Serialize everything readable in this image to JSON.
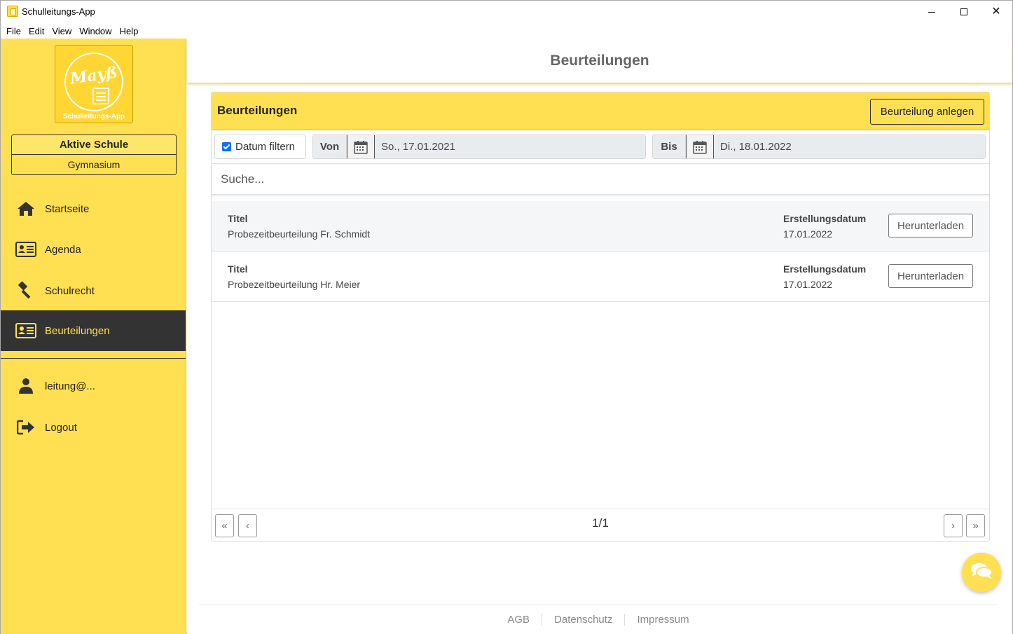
{
  "window": {
    "title": "Schulleitungs-App",
    "icon": "app-icon"
  },
  "menubar": [
    "File",
    "Edit",
    "View",
    "Window",
    "Help"
  ],
  "sidebar": {
    "logo_script": "Mayß",
    "logo_caption": "Schulleitungs-App",
    "school_heading": "Aktive Schule",
    "school_name": "Gymnasium",
    "items": [
      {
        "label": "Startseite",
        "icon": "home-icon"
      },
      {
        "label": "Agenda",
        "icon": "id-card-icon"
      },
      {
        "label": "Schulrecht",
        "icon": "gavel-icon"
      },
      {
        "label": "Beurteilungen",
        "icon": "id-card-icon",
        "active": true
      }
    ],
    "user_items": [
      {
        "label": "leitung@...",
        "icon": "user-icon"
      },
      {
        "label": "Logout",
        "icon": "logout-icon"
      }
    ]
  },
  "header": {
    "title": "Beurteilungen"
  },
  "card": {
    "title": "Beurteilungen",
    "create_label": "Beurteilung anlegen",
    "filter": {
      "checkbox_label": "Datum filtern",
      "checked": true,
      "from_label": "Von",
      "from_value": "So., 17.01.2021",
      "to_label": "Bis",
      "to_value": "Di., 18.01.2022"
    },
    "search_placeholder": "Suche...",
    "rows": [
      {
        "title_label": "Titel",
        "title": "Probezeitbeurteilung Fr. Schmidt",
        "date_label": "Erstellungsdatum",
        "date": "17.01.2022",
        "download_label": "Herunterladen"
      },
      {
        "title_label": "Titel",
        "title": "Probezeitbeurteilung Hr. Meier",
        "date_label": "Erstellungsdatum",
        "date": "17.01.2022",
        "download_label": "Herunterladen"
      }
    ],
    "pager": {
      "text": "1/1"
    }
  },
  "footer": [
    "AGB",
    "Datenschutz",
    "Impressum"
  ],
  "colors": {
    "accent": "#ffe052",
    "active_nav": "#333333",
    "checkbox": "#0d6efd"
  }
}
